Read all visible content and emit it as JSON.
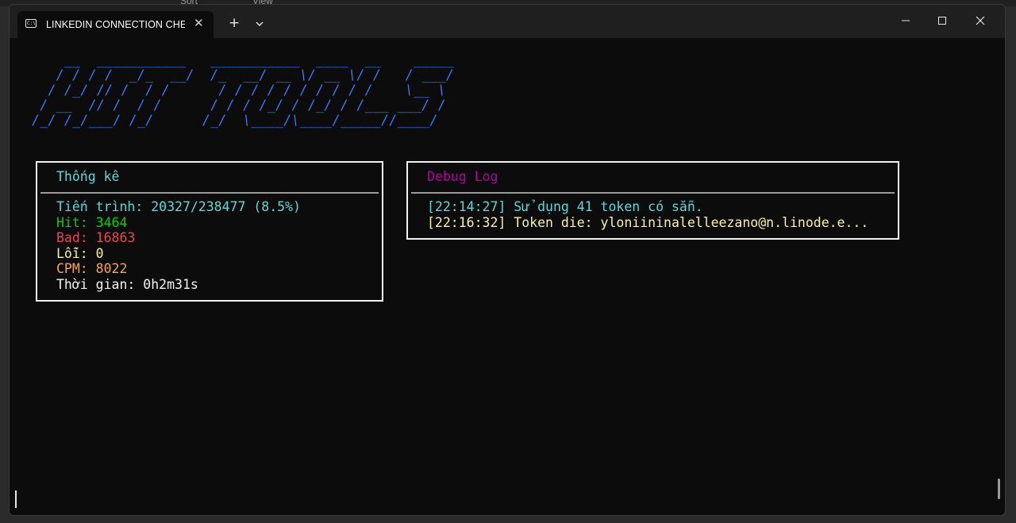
{
  "tab": {
    "title": "LINKEDIN CONNECTION CHECKER",
    "close_glyph": "✕",
    "new_glyph": "+",
    "dropdown_glyph": "⌄",
    "icon_text": "C:\\"
  },
  "banner_art": "    __  ___________   ___________  ____  __    _____\n   / / / /  _/_  __/  /_  __/ __ \\/ __ \\/ /   / ___/\n  / /_/ // /  / /      / / / / / / / / / /    \\__ \\ \n / __  // /  / /      / / / /_/ / /_/ / /___ ___/ / \n/_/ /_/___/ /_/      /_/  \\____/\\____/_____//____/  ",
  "stats": {
    "title": "Thống kê",
    "progress": "Tiến trình: 20327/238477 (8.5%)",
    "hit": "Hit: 3464",
    "bad": "Bad: 16863",
    "errors": "Lỗi: 0",
    "cpm": "CPM: 8022",
    "time": "Thời gian: 0h2m31s"
  },
  "debug": {
    "title": "Debug Log",
    "lines": [
      "[22:14:27] Sử dụng 41 token có sẵn.",
      "[22:16:32] Token die: yloniininalelleezano@n.linode.e..."
    ]
  },
  "colors": {
    "terminal_bg": "#0c0c0c",
    "banner": "#3b78ff",
    "stats_title": "#61d6d6",
    "progress": "#61d6d6",
    "hit": "#16c60c",
    "bad": "#e74856",
    "errors": "#f9f1a5",
    "cpm": "#f7a35c",
    "time": "#f2f2f2",
    "debug_title": "#b4009e",
    "log_info": "#61d6d6",
    "log_warn": "#f9f1a5"
  },
  "explorer_behind": {
    "sort_label": "Sort",
    "view_label": "View"
  }
}
